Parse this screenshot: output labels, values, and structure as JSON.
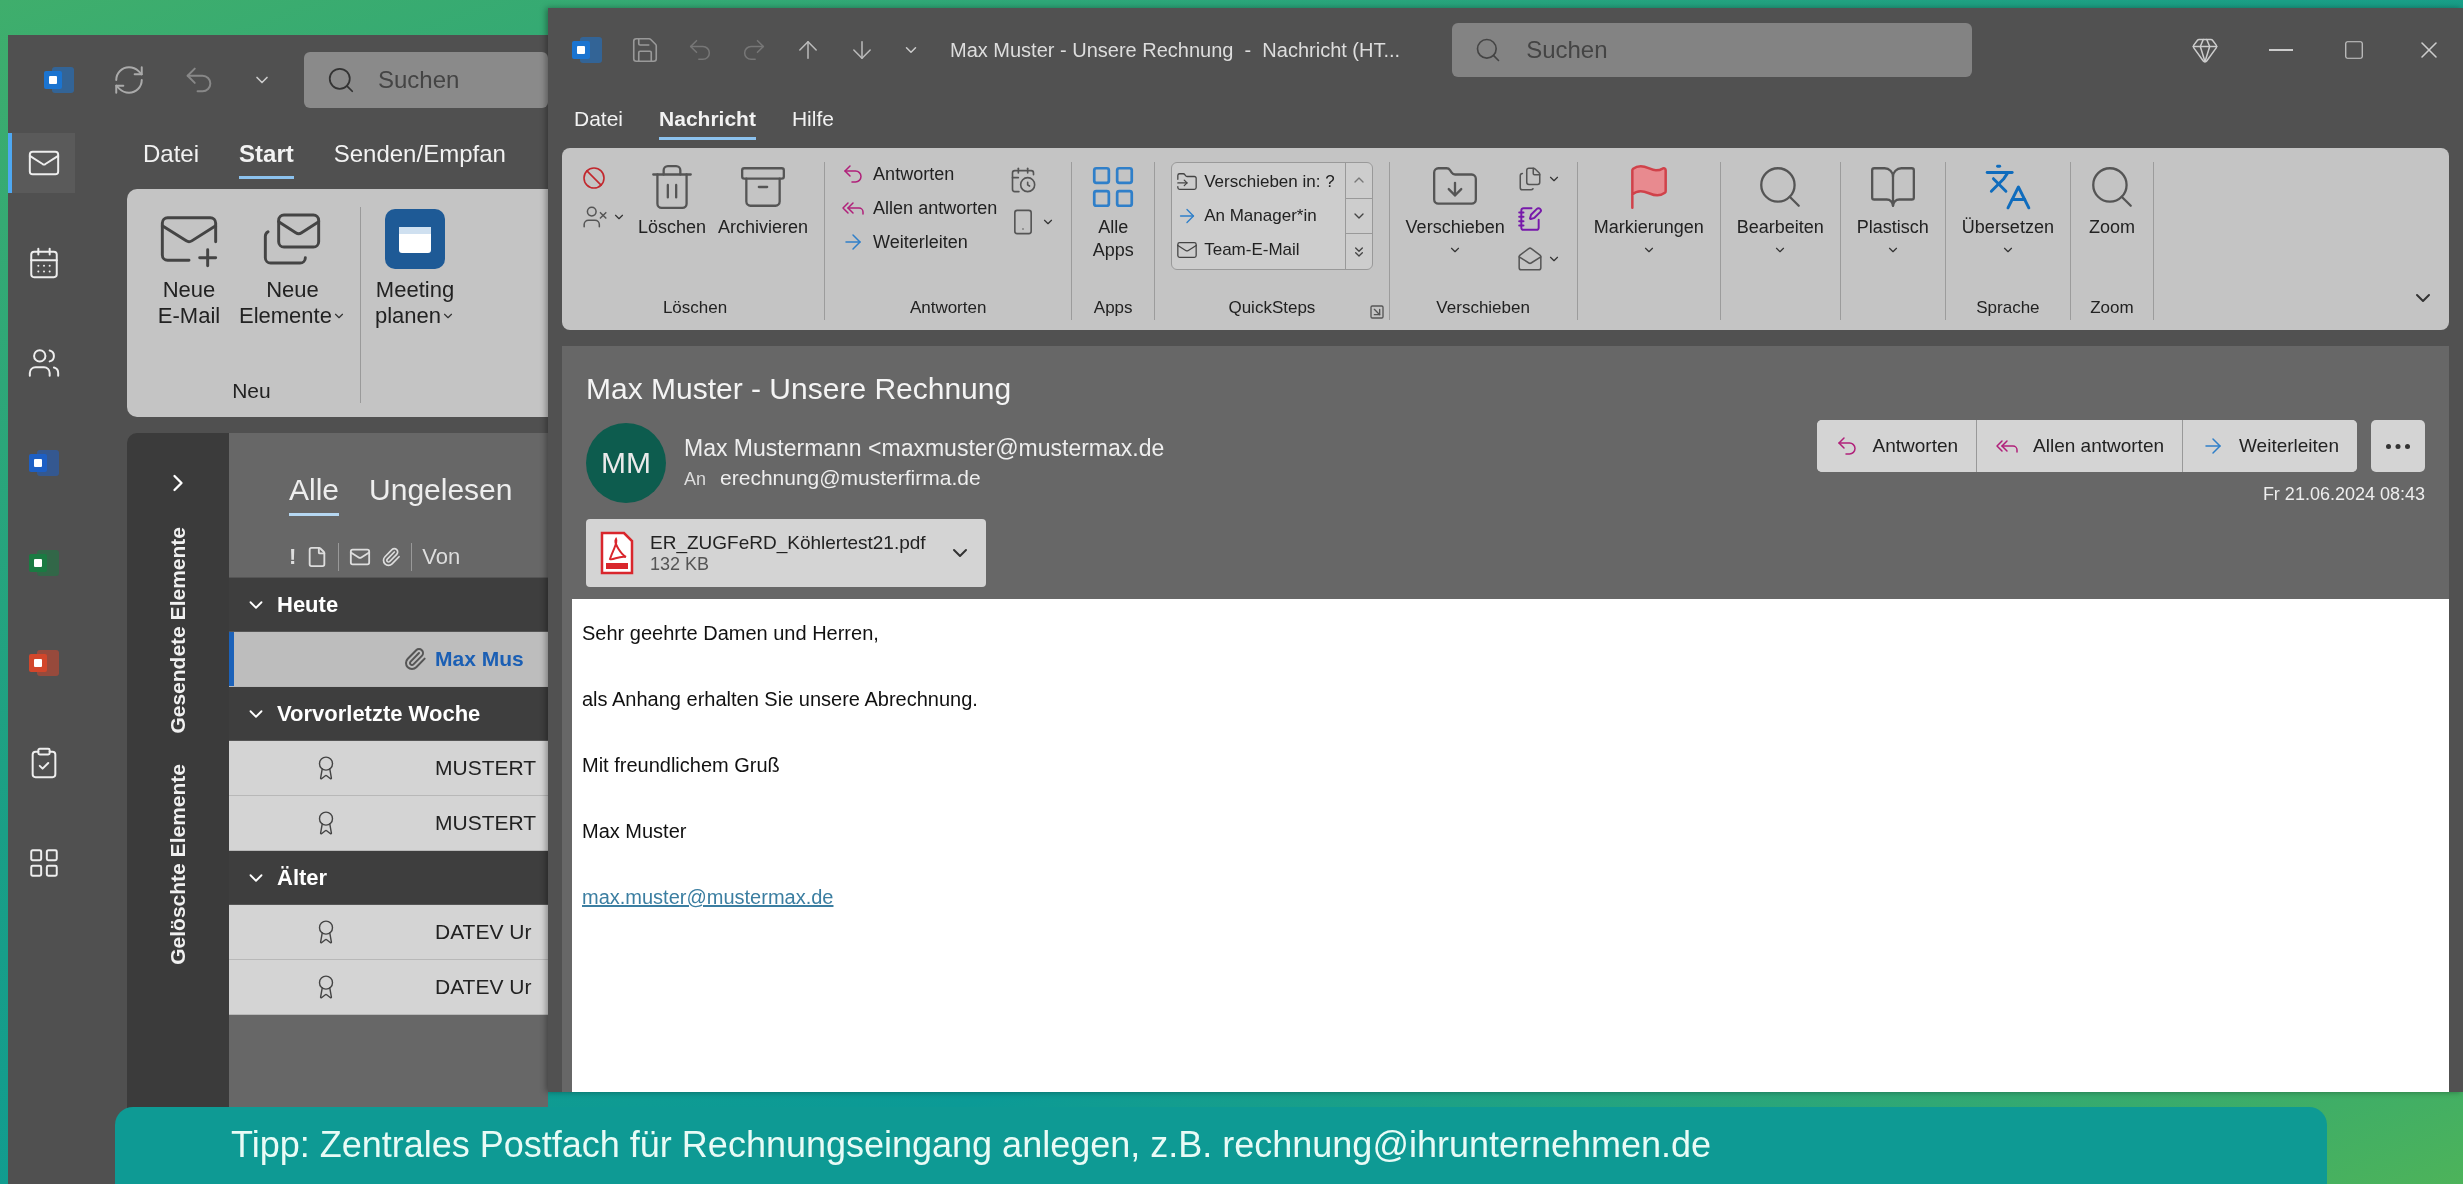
{
  "main_window": {
    "search_placeholder": "Suchen",
    "nav_items": [
      {
        "kind": "mail",
        "selected": true
      },
      {
        "kind": "calendar",
        "selected": false
      },
      {
        "kind": "people",
        "selected": false
      },
      {
        "kind": "word",
        "selected": false
      },
      {
        "kind": "excel",
        "selected": false
      },
      {
        "kind": "powerpoint",
        "selected": false
      },
      {
        "kind": "tasks",
        "selected": false
      },
      {
        "kind": "apps",
        "selected": false
      }
    ],
    "menu_tabs": [
      {
        "label": "Datei",
        "selected": false
      },
      {
        "label": "Start",
        "selected": true
      },
      {
        "label": "Senden/Empfan",
        "selected": false
      }
    ],
    "ribbon_groups": [
      {
        "label": "Neu",
        "buttons": [
          {
            "label": "Neue\nE-Mail",
            "dropdown": false
          },
          {
            "label": "Neue\nElemente",
            "dropdown": true
          }
        ]
      },
      {
        "buttons": [
          {
            "label": "Meeting\nplanen",
            "dropdown": true
          }
        ]
      }
    ],
    "folder_pane": {
      "folders": [
        "Gesendete Elemente",
        "Gelöschte Elemente"
      ]
    },
    "mail_list": {
      "tabs": [
        {
          "label": "Alle",
          "selected": true
        },
        {
          "label": "Ungelesen",
          "selected": false
        }
      ],
      "columns": {
        "importance": "!",
        "sender": "Von"
      },
      "groups": [
        {
          "label": "Heute",
          "expanded": true,
          "rows": [
            {
              "sender": "Max Mus",
              "selected": true,
              "unread": true,
              "attachment": true,
              "certificate": false
            }
          ]
        },
        {
          "label": "Vorvorletzte Woche",
          "expanded": true,
          "rows": [
            {
              "sender": "MUSTERT",
              "selected": false,
              "unread": false,
              "attachment": false,
              "certificate": true
            },
            {
              "sender": "MUSTERT",
              "selected": false,
              "unread": false,
              "attachment": false,
              "certificate": true
            }
          ]
        },
        {
          "label": "Älter",
          "expanded": true,
          "rows": [
            {
              "sender": "DATEV Ur",
              "selected": false,
              "unread": false,
              "attachment": false,
              "certificate": true
            },
            {
              "sender": "DATEV Ur",
              "selected": false,
              "unread": false,
              "attachment": false,
              "certificate": true
            }
          ]
        }
      ]
    }
  },
  "message_window": {
    "title": "Max Muster - Unsere Rechnung  -  Nachricht (HT...",
    "search_placeholder": "Suchen",
    "menu_tabs": [
      {
        "label": "Datei",
        "selected": false
      },
      {
        "label": "Nachricht",
        "selected": true
      },
      {
        "label": "Hilfe",
        "selected": false
      }
    ],
    "ribbon_groups": [
      {
        "label": "Löschen",
        "items": [
          {
            "kind": "icon",
            "dropdown": false
          },
          {
            "kind": "icon",
            "dropdown": true
          },
          {
            "kind": "large",
            "label": "Löschen",
            "dropdown": false
          },
          {
            "kind": "large",
            "label": "Archivieren",
            "dropdown": false
          }
        ]
      },
      {
        "label": "Antworten",
        "items": [
          {
            "kind": "small",
            "label": "Antworten"
          },
          {
            "kind": "small",
            "label": "Allen antworten"
          },
          {
            "kind": "small",
            "label": "Weiterleiten"
          },
          {
            "kind": "icon",
            "dropdown": false
          },
          {
            "kind": "icon",
            "dropdown": true
          }
        ]
      },
      {
        "label": "Apps",
        "items": [
          {
            "kind": "large",
            "label": "Alle\nApps",
            "dropdown": false
          }
        ]
      },
      {
        "label": "QuickSteps",
        "launcher": true,
        "items": [
          {
            "kind": "gallery",
            "entries": [
              "Verschieben in: ?",
              "An Manager*in",
              "Team-E-Mail"
            ]
          }
        ]
      },
      {
        "label": "Verschieben",
        "items": [
          {
            "kind": "large",
            "label": "Verschieben",
            "dropdown": true
          },
          {
            "kind": "icon",
            "dropdown": true
          },
          {
            "kind": "icon",
            "dropdown": false
          },
          {
            "kind": "icon",
            "dropdown": true
          }
        ]
      },
      {
        "items": [
          {
            "kind": "large",
            "label": "Markierungen",
            "dropdown": true
          }
        ]
      },
      {
        "items": [
          {
            "kind": "large",
            "label": "Bearbeiten",
            "dropdown": true
          }
        ]
      },
      {
        "items": [
          {
            "kind": "large",
            "label": "Plastisch",
            "dropdown": true
          }
        ]
      },
      {
        "label": "Sprache",
        "items": [
          {
            "kind": "large",
            "label": "Übersetzen",
            "dropdown": true
          }
        ]
      },
      {
        "label": "Zoom",
        "items": [
          {
            "kind": "large",
            "label": "Zoom",
            "dropdown": false
          }
        ]
      }
    ],
    "subject": "Max Muster - Unsere Rechnung",
    "avatar_initials": "MM",
    "sender": "Max Mustermann <maxmuster@mustermax.de",
    "to_label": "An",
    "to": "erechnung@musterfirma.de",
    "attachment": {
      "name": "ER_ZUGFeRD_Köhlertest21.pdf",
      "size": "132 KB"
    },
    "actions": [
      "Antworten",
      "Allen antworten",
      "Weiterleiten"
    ],
    "date": "Fr 21.06.2024 08:43",
    "body": [
      "Sehr geehrte Damen und Herren,",
      "als Anhang erhalten Sie unsere Abrechnung.",
      "Mit freundlichem Gruß",
      "Max Muster"
    ],
    "signature_link": "max.muster@mustermax.de"
  },
  "tip": "Tipp: Zentrales Postfach für Rechnungseingang anlegen, z.B. rechnung@ihrunternehmen.de"
}
